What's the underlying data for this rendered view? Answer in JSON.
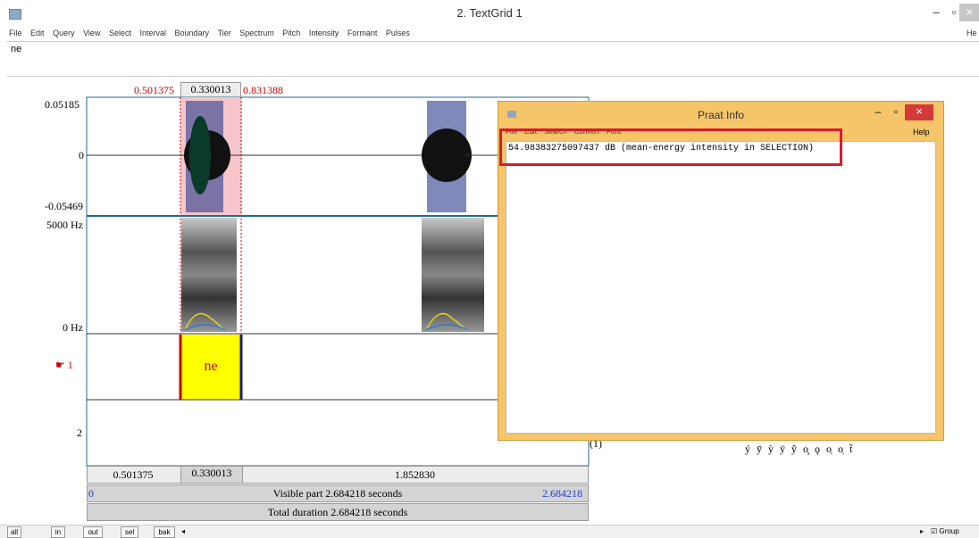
{
  "window": {
    "title": "2. TextGrid 1",
    "min": "–",
    "restore": "▫",
    "close": "×",
    "help_cut": "He"
  },
  "menu": [
    "File",
    "Edit",
    "Query",
    "View",
    "Select",
    "Interval",
    "Boundary",
    "Tier",
    "Spectrum",
    "Pitch",
    "Intensity",
    "Formant",
    "Pulses"
  ],
  "textarea": {
    "value": "ne"
  },
  "selection": {
    "start": "0.501375",
    "duration": "0.330013",
    "end": "0.831388"
  },
  "wave": {
    "max": "0.05185",
    "zero": "0",
    "min": "-0.05469"
  },
  "spectrum": {
    "top": "5000 Hz",
    "bottom": "0 Hz"
  },
  "tiers": {
    "tier1_marker": "☛ 1",
    "interval_text": "ne",
    "tier2": "2"
  },
  "bottom": {
    "row1": [
      "0.501375",
      "0.330013",
      "1.852830"
    ],
    "visible_start": "0",
    "visible_label": "Visible part 2.684218 seconds",
    "visible_end": "2.684218",
    "total_label": "Total duration 2.684218 seconds"
  },
  "buttons": {
    "all": "all",
    "in": "in",
    "out": "out",
    "sel": "sel",
    "bak": "bak",
    "group": "Group"
  },
  "info": {
    "title": "Praat Info",
    "menu": [
      "File",
      "Edit",
      "Search",
      "Convert",
      "Font"
    ],
    "help": "Help",
    "output": "54.98383275097437 dB (mean-energy intensity in SELECTION)",
    "min": "–",
    "restore": "▫",
    "close": "×"
  },
  "ipa_fragment": "(1)",
  "ipa_symbols": "ý ȳ ỳ ÿ ỹ o̧ ǫ o̜ o̹ t̃",
  "colors": {
    "selection": "#f6c6cc",
    "interval_fill": "#ffff00",
    "accent_red": "#c00000",
    "info_bg": "#f5c56a",
    "highlight_box": "#d91c2c"
  }
}
